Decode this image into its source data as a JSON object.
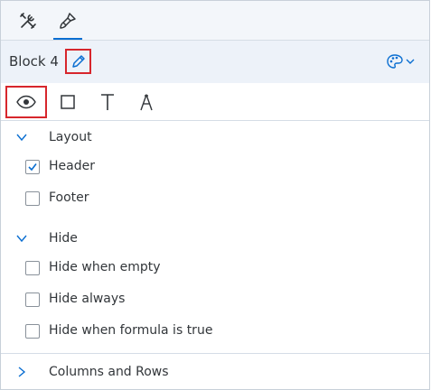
{
  "toolbar": {
    "tabs": [
      {
        "icon": "tools-icon"
      },
      {
        "icon": "paintbrush-icon",
        "active": true
      }
    ]
  },
  "block": {
    "title": "Block 4",
    "edit_icon": "pencil-icon",
    "palette_icon": "palette-icon"
  },
  "format_tabs": [
    {
      "icon": "eye-icon",
      "selected": true
    },
    {
      "icon": "border-box-icon"
    },
    {
      "icon": "text-icon"
    },
    {
      "icon": "text-style-icon"
    }
  ],
  "sections": {
    "layout": {
      "label": "Layout",
      "expanded": true,
      "options": [
        {
          "label": "Header",
          "checked": true
        },
        {
          "label": "Footer",
          "checked": false
        }
      ]
    },
    "hide": {
      "label": "Hide",
      "expanded": true,
      "options": [
        {
          "label": "Hide when empty",
          "checked": false
        },
        {
          "label": "Hide always",
          "checked": false
        },
        {
          "label": "Hide when formula is true",
          "checked": false
        }
      ]
    },
    "columns_rows": {
      "label": "Columns and Rows",
      "expanded": false
    }
  },
  "colors": {
    "accent": "#0a6ed1",
    "highlight_border": "#d7262c",
    "header_bg": "#edf2f9"
  }
}
